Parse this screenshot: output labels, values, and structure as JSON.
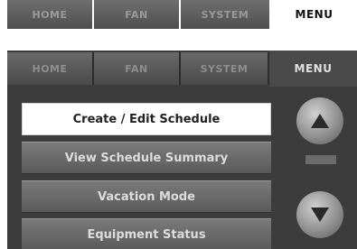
{
  "top_tabs": [
    {
      "label": "HOME",
      "selected": false
    },
    {
      "label": "FAN",
      "selected": false
    },
    {
      "label": "SYSTEM",
      "selected": false
    },
    {
      "label": "MENU",
      "selected": true
    }
  ],
  "panel": {
    "tabs": [
      {
        "label": "HOME",
        "selected": false
      },
      {
        "label": "FAN",
        "selected": false
      },
      {
        "label": "SYSTEM",
        "selected": false
      },
      {
        "label": "MENU",
        "selected": true
      }
    ],
    "menu_items": [
      {
        "label": "Create / Edit Schedule",
        "selected": true
      },
      {
        "label": "View Schedule Summary",
        "selected": false
      },
      {
        "label": "Vacation Mode",
        "selected": false
      },
      {
        "label": "Equipment Status",
        "selected": false
      }
    ],
    "scroll_up_icon": "up-arrow-icon",
    "scroll_down_icon": "down-arrow-icon"
  },
  "colors": {
    "panel_bg": "#3c3c3c",
    "tab_text": "#8e8e8e",
    "selected_button_bg": "#ffffff"
  }
}
